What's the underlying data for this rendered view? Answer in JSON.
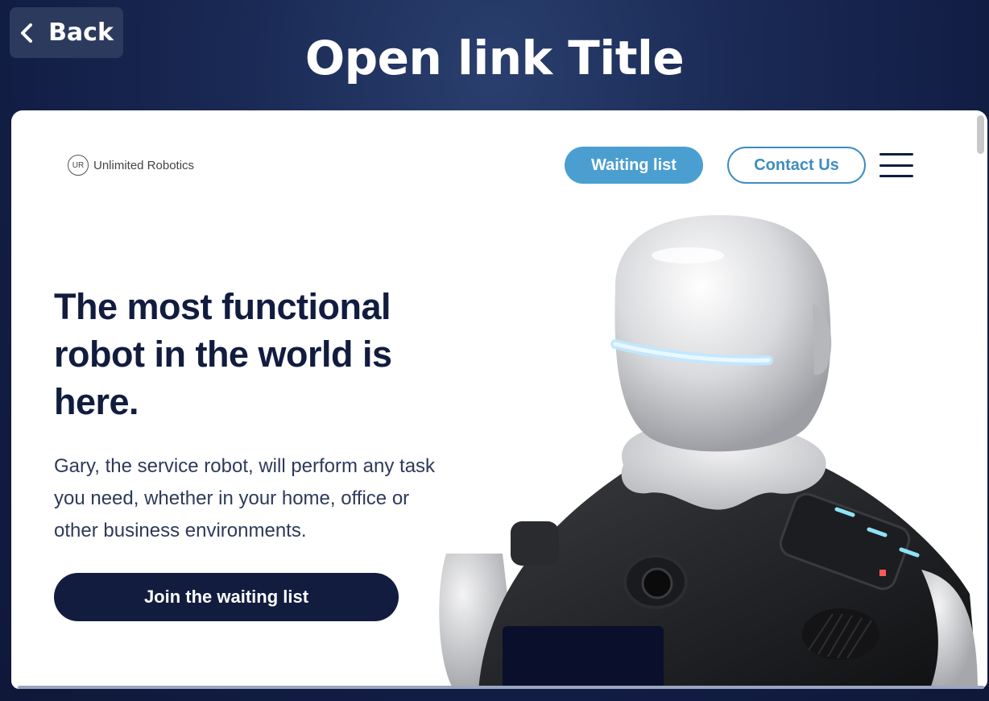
{
  "header": {
    "back_label": "Back",
    "title": "Open link Title"
  },
  "site": {
    "brand_name": "Unlimited Robotics",
    "brand_logo_text": "UR",
    "nav": {
      "waiting_label": "Waiting list",
      "contact_label": "Contact Us"
    },
    "hero": {
      "headline": "The most functional robot in the world is here.",
      "subtext": "Gary, the service robot, will perform any task you need, whether in your home, office or other business environments.",
      "cta_label": "Join the waiting list"
    }
  },
  "colors": {
    "background": "#1a2a55",
    "accent": "#4a9fd0",
    "navy": "#111c3f"
  }
}
